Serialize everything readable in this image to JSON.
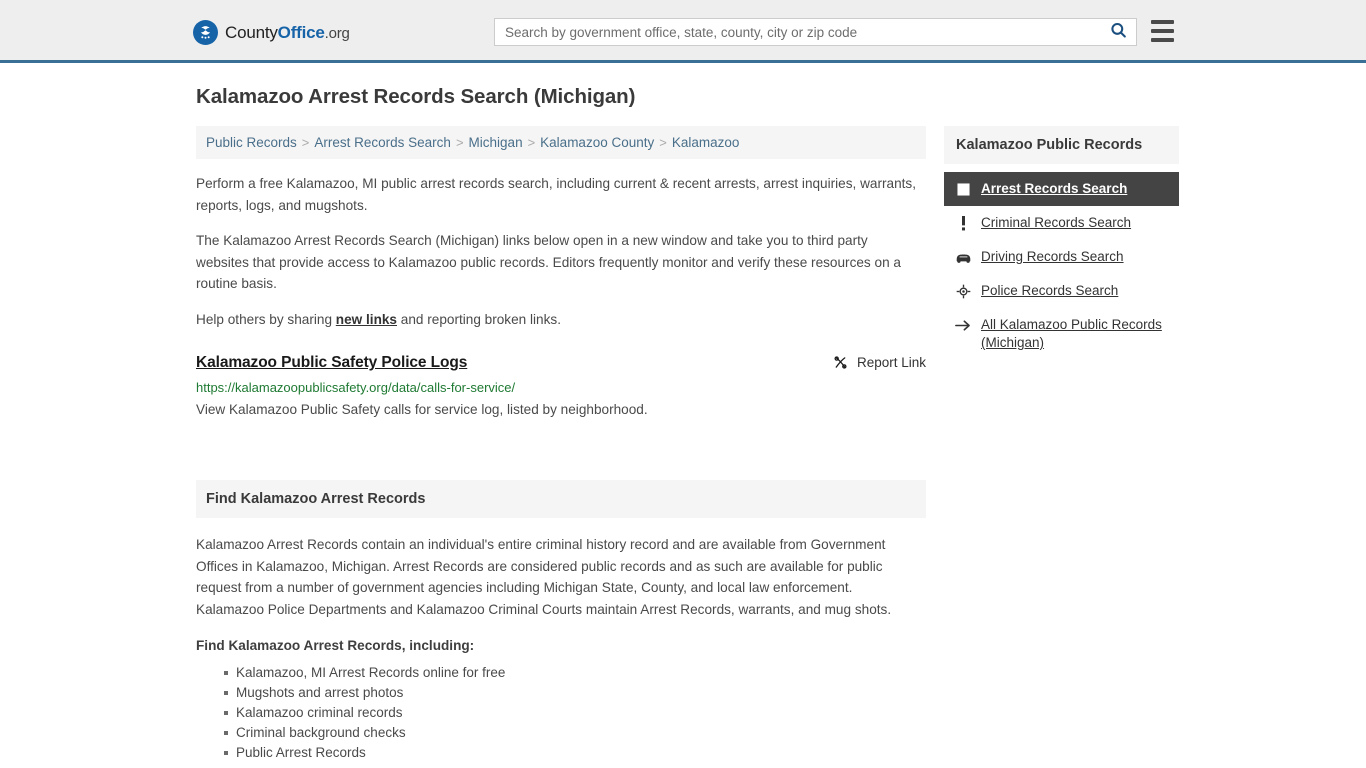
{
  "header": {
    "logo": {
      "icon": "eagle-seal-icon",
      "text_part1": "County",
      "text_part2": "Office",
      "text_part3": ".org"
    },
    "search": {
      "placeholder": "Search by government office, state, county, city or zip code",
      "value": "",
      "button_icon": "search-icon"
    },
    "menu_icon": "hamburger-menu-icon",
    "accent_color": "#3b7096"
  },
  "page": {
    "title": "Kalamazoo Arrest Records Search (Michigan)"
  },
  "breadcrumb": {
    "separator": ">",
    "items": [
      {
        "label": "Public Records"
      },
      {
        "label": "Arrest Records Search"
      },
      {
        "label": "Michigan"
      },
      {
        "label": "Kalamazoo County"
      },
      {
        "label": "Kalamazoo"
      }
    ]
  },
  "intro": {
    "p1": "Perform a free Kalamazoo, MI public arrest records search, including current & recent arrests, arrest inquiries, warrants, reports, logs, and mugshots.",
    "p2": "The Kalamazoo Arrest Records Search (Michigan) links below open in a new window and take you to third party websites that provide access to Kalamazoo public records. Editors frequently monitor and verify these resources on a routine basis.",
    "p3_before": "Help others by sharing ",
    "p3_link": "new links",
    "p3_after": " and reporting broken links."
  },
  "result": {
    "title": "Kalamazoo Public Safety Police Logs",
    "url": "https://kalamazoopublicsafety.org/data/calls-for-service/",
    "description": "View Kalamazoo Public Safety calls for service log, listed by neighborhood.",
    "report_label": "Report Link",
    "report_icon": "broken-link-icon",
    "url_color": "#1f7a33"
  },
  "section": {
    "heading": "Find Kalamazoo Arrest Records",
    "body": "Kalamazoo Arrest Records contain an individual's entire criminal history record and are available from Government Offices in Kalamazoo, Michigan. Arrest Records are considered public records and as such are available for public request from a number of government agencies including Michigan State, County, and local law enforcement. Kalamazoo Police Departments and Kalamazoo Criminal Courts maintain Arrest Records, warrants, and mug shots.",
    "subheading": "Find Kalamazoo Arrest Records, including:",
    "bullets": [
      "Kalamazoo, MI Arrest Records online for free",
      "Mugshots and arrest photos",
      "Kalamazoo criminal records",
      "Criminal background checks",
      "Public Arrest Records"
    ]
  },
  "sidebar": {
    "heading": "Kalamazoo Public Records",
    "active_bg": "#444444",
    "items": [
      {
        "label": "Arrest Records Search",
        "icon": "filled-square-icon",
        "active": true
      },
      {
        "label": "Criminal Records Search",
        "icon": "exclamation-mark-icon",
        "active": false
      },
      {
        "label": "Driving Records Search",
        "icon": "car-icon",
        "active": false
      },
      {
        "label": "Police Records Search",
        "icon": "police-badge-icon",
        "active": false
      },
      {
        "label": "All Kalamazoo Public Records (Michigan)",
        "icon": "arrow-right-icon",
        "active": false
      }
    ]
  }
}
